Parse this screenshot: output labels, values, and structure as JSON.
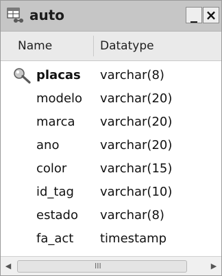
{
  "window": {
    "title": "auto",
    "minimize_label": "_",
    "close_label": "×"
  },
  "columns": {
    "name": "Name",
    "datatype": "Datatype"
  },
  "rows": [
    {
      "name": "placas",
      "datatype": "varchar(8)",
      "primary_key": true
    },
    {
      "name": "modelo",
      "datatype": "varchar(20)"
    },
    {
      "name": "marca",
      "datatype": "varchar(20)"
    },
    {
      "name": "ano",
      "datatype": "varchar(20)"
    },
    {
      "name": "color",
      "datatype": "varchar(15)"
    },
    {
      "name": "id_tag",
      "datatype": "varchar(10)"
    },
    {
      "name": "estado",
      "datatype": "varchar(8)"
    },
    {
      "name": "fa_act",
      "datatype": "timestamp"
    }
  ],
  "scrollbar": {
    "left_arrow": "◀",
    "right_arrow": "▶",
    "grip": "III"
  },
  "icons": {
    "title": "table-icon",
    "primary_key": "key-icon"
  },
  "colors": {
    "titlebar": "#c6c6c6",
    "header": "#eaeaea",
    "text": "#111111"
  }
}
